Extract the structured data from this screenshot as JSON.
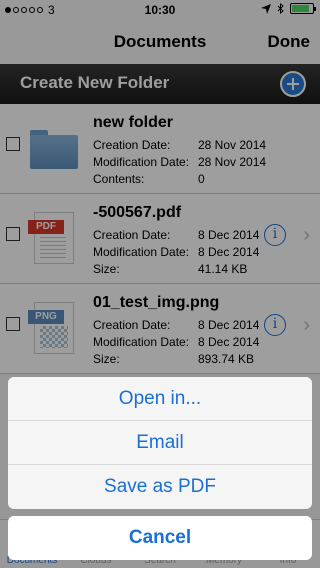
{
  "status": {
    "carrier": "3",
    "time": "10:30",
    "signal": [
      true,
      false,
      false,
      false,
      false
    ],
    "battery_level": 0.85
  },
  "nav": {
    "title": "Documents",
    "done_label": "Done"
  },
  "create_folder": {
    "label": "Create New Folder"
  },
  "files": [
    {
      "name": "new folder",
      "icon": "folder-icon",
      "fields": [
        {
          "label": "Creation Date:",
          "value": "28 Nov 2014"
        },
        {
          "label": "Modification Date:",
          "value": "28 Nov 2014"
        },
        {
          "label": "Contents:",
          "value": "0"
        }
      ]
    },
    {
      "name": "-500567.pdf",
      "icon": "pdf-icon",
      "badge": "PDF",
      "fields": [
        {
          "label": "Creation Date:",
          "value": "8 Dec 2014"
        },
        {
          "label": "Modification Date:",
          "value": "8 Dec 2014"
        },
        {
          "label": "Size:",
          "value": "41.14 KB"
        }
      ]
    },
    {
      "name": "01_test_img.png",
      "icon": "png-icon",
      "badge": "PNG",
      "fields": [
        {
          "label": "Creation Date:",
          "value": "8 Dec 2014"
        },
        {
          "label": "Modification Date:",
          "value": "8 Dec 2014"
        },
        {
          "label": "Size:",
          "value": "893.74 KB"
        }
      ]
    }
  ],
  "tabs": [
    {
      "label": "Documents",
      "active": true
    },
    {
      "label": "Clouds"
    },
    {
      "label": "Search"
    },
    {
      "label": "Memory"
    },
    {
      "label": "Info"
    }
  ],
  "action_sheet": {
    "options": [
      "Open in...",
      "Email",
      "Save as PDF"
    ],
    "cancel": "Cancel"
  },
  "colors": {
    "accent": "#1a6fd6",
    "header_dark": "#222222",
    "battery": "#4cd964"
  }
}
